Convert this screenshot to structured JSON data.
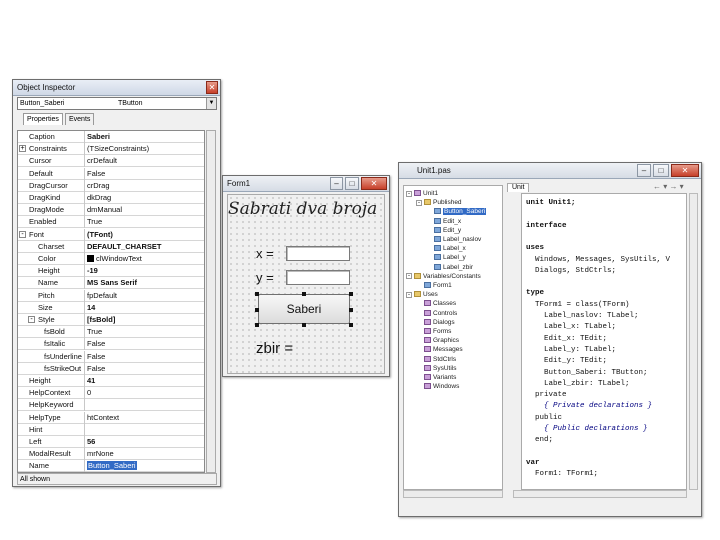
{
  "object_inspector": {
    "title": "Object Inspector",
    "selected_component": "Button_Saberi",
    "selected_type": "TButton",
    "tabs": [
      "Properties",
      "Events"
    ],
    "properties": [
      {
        "name": "Caption",
        "value": "Saberi",
        "bold": true
      },
      {
        "name": "Constraints",
        "value": "(TSizeConstraints)",
        "expander": "+"
      },
      {
        "name": "Cursor",
        "value": "crDefault"
      },
      {
        "name": "Default",
        "value": "False"
      },
      {
        "name": "DragCursor",
        "value": "crDrag"
      },
      {
        "name": "DragKind",
        "value": "dkDrag"
      },
      {
        "name": "DragMode",
        "value": "dmManual"
      },
      {
        "name": "Enabled",
        "value": "True"
      },
      {
        "name": "Font",
        "value": "(TFont)",
        "expander": "-",
        "bold": true
      },
      {
        "name": "Charset",
        "value": "DEFAULT_CHARSET",
        "bold": true,
        "indent": true
      },
      {
        "name": "Color",
        "value": "clWindowText",
        "swatch": true,
        "indent": true
      },
      {
        "name": "Height",
        "value": "-19",
        "bold": true,
        "indent": true
      },
      {
        "name": "Name",
        "value": "MS Sans Serif",
        "bold": true,
        "indent": true
      },
      {
        "name": "Pitch",
        "value": "fpDefault",
        "indent": true
      },
      {
        "name": "Size",
        "value": "14",
        "bold": true,
        "indent": true
      },
      {
        "name": "Style",
        "value": "[fsBold]",
        "expander": "-",
        "bold": true,
        "indent": true
      },
      {
        "name": "fsBold",
        "value": "True",
        "indent2": true
      },
      {
        "name": "fsItalic",
        "value": "False",
        "indent2": true
      },
      {
        "name": "fsUnderline",
        "value": "False",
        "indent2": true
      },
      {
        "name": "fsStrikeOut",
        "value": "False",
        "indent2": true
      },
      {
        "name": "Height",
        "value": "41",
        "bold": true
      },
      {
        "name": "HelpContext",
        "value": "0"
      },
      {
        "name": "HelpKeyword",
        "value": ""
      },
      {
        "name": "HelpType",
        "value": "htContext"
      },
      {
        "name": "Hint",
        "value": ""
      },
      {
        "name": "Left",
        "value": "56",
        "bold": true
      },
      {
        "name": "ModalResult",
        "value": "mrNone"
      },
      {
        "name": "Name",
        "value": "Button_Saberi",
        "selected": true
      }
    ],
    "status": "All shown"
  },
  "form1": {
    "title": "Form1",
    "heading": "Sabrati dva broja",
    "label_x": "x =",
    "label_y": "y =",
    "button": "Saberi",
    "label_zbir": "zbir ="
  },
  "unit1": {
    "title": "Unit1.pas",
    "tab": "Unit",
    "tree": [
      {
        "label": "Unit1",
        "level": 0,
        "icon": "unit",
        "exp": "-"
      },
      {
        "label": "Published",
        "level": 1,
        "icon": "folder",
        "exp": "-"
      },
      {
        "label": "Button_Saberi",
        "level": 2,
        "icon": "item",
        "selected": true
      },
      {
        "label": "Edit_x",
        "level": 2,
        "icon": "item"
      },
      {
        "label": "Edit_y",
        "level": 2,
        "icon": "item"
      },
      {
        "label": "Label_naslov",
        "level": 2,
        "icon": "item"
      },
      {
        "label": "Label_x",
        "level": 2,
        "icon": "item"
      },
      {
        "label": "Label_y",
        "level": 2,
        "icon": "item"
      },
      {
        "label": "Label_zbir",
        "level": 2,
        "icon": "item"
      },
      {
        "label": "Variables/Constants",
        "level": 0,
        "icon": "folder",
        "exp": "-"
      },
      {
        "label": "Form1",
        "level": 1,
        "icon": "item"
      },
      {
        "label": "Uses",
        "level": 0,
        "icon": "folder",
        "exp": "-"
      },
      {
        "label": "Classes",
        "level": 1,
        "icon": "unit"
      },
      {
        "label": "Controls",
        "level": 1,
        "icon": "unit"
      },
      {
        "label": "Dialogs",
        "level": 1,
        "icon": "unit"
      },
      {
        "label": "Forms",
        "level": 1,
        "icon": "unit"
      },
      {
        "label": "Graphics",
        "level": 1,
        "icon": "unit"
      },
      {
        "label": "Messages",
        "level": 1,
        "icon": "unit"
      },
      {
        "label": "StdCtrls",
        "level": 1,
        "icon": "unit"
      },
      {
        "label": "SysUtils",
        "level": 1,
        "icon": "unit"
      },
      {
        "label": "Variants",
        "level": 1,
        "icon": "unit"
      },
      {
        "label": "Windows",
        "level": 1,
        "icon": "unit"
      }
    ],
    "code": [
      {
        "text": "unit Unit1;",
        "style": "bold"
      },
      {
        "text": "",
        "style": ""
      },
      {
        "text": "interface",
        "style": "bold"
      },
      {
        "text": "",
        "style": ""
      },
      {
        "text": "uses",
        "style": "bold"
      },
      {
        "text": "  Windows, Messages, SysUtils, V",
        "style": ""
      },
      {
        "text": "  Dialogs, StdCtrls;",
        "style": ""
      },
      {
        "text": "",
        "style": ""
      },
      {
        "text": "type",
        "style": "bold"
      },
      {
        "text": "  TForm1 = class(TForm)",
        "style": ""
      },
      {
        "text": "    Label_naslov: TLabel;",
        "style": ""
      },
      {
        "text": "    Label_x: TLabel;",
        "style": ""
      },
      {
        "text": "    Edit_x: TEdit;",
        "style": ""
      },
      {
        "text": "    Label_y: TLabel;",
        "style": ""
      },
      {
        "text": "    Edit_y: TEdit;",
        "style": ""
      },
      {
        "text": "    Button_Saberi: TButton;",
        "style": ""
      },
      {
        "text": "    Label_zbir: TLabel;",
        "style": ""
      },
      {
        "text": "  private",
        "style": ""
      },
      {
        "text": "    { Private declarations }",
        "style": "com"
      },
      {
        "text": "  public",
        "style": ""
      },
      {
        "text": "    { Public declarations }",
        "style": "com"
      },
      {
        "text": "  end;",
        "style": ""
      },
      {
        "text": "",
        "style": ""
      },
      {
        "text": "var",
        "style": "bold"
      },
      {
        "text": "  Form1: TForm1;",
        "style": ""
      }
    ]
  },
  "colors": {
    "selection": "#316ac5",
    "close_button": "#c7402a"
  }
}
